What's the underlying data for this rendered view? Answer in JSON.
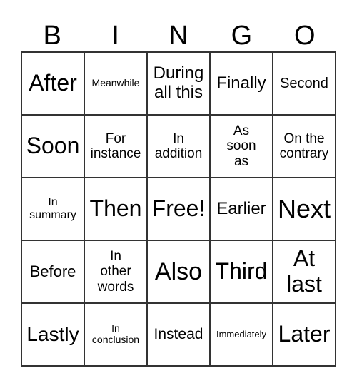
{
  "header": [
    "B",
    "I",
    "N",
    "G",
    "O"
  ],
  "cells": [
    "After",
    "Meanwhile",
    "During all this",
    "Finally",
    "Second",
    "Soon",
    "For instance",
    "In addition",
    "As soon as",
    "On the contrary",
    "In summary",
    "Then",
    "Free!",
    "Earlier",
    "Next",
    "Before",
    "In other words",
    "Also",
    "Third",
    "At last",
    "Lastly",
    "In conclusion",
    "Instead",
    "Immediately",
    "Later"
  ]
}
